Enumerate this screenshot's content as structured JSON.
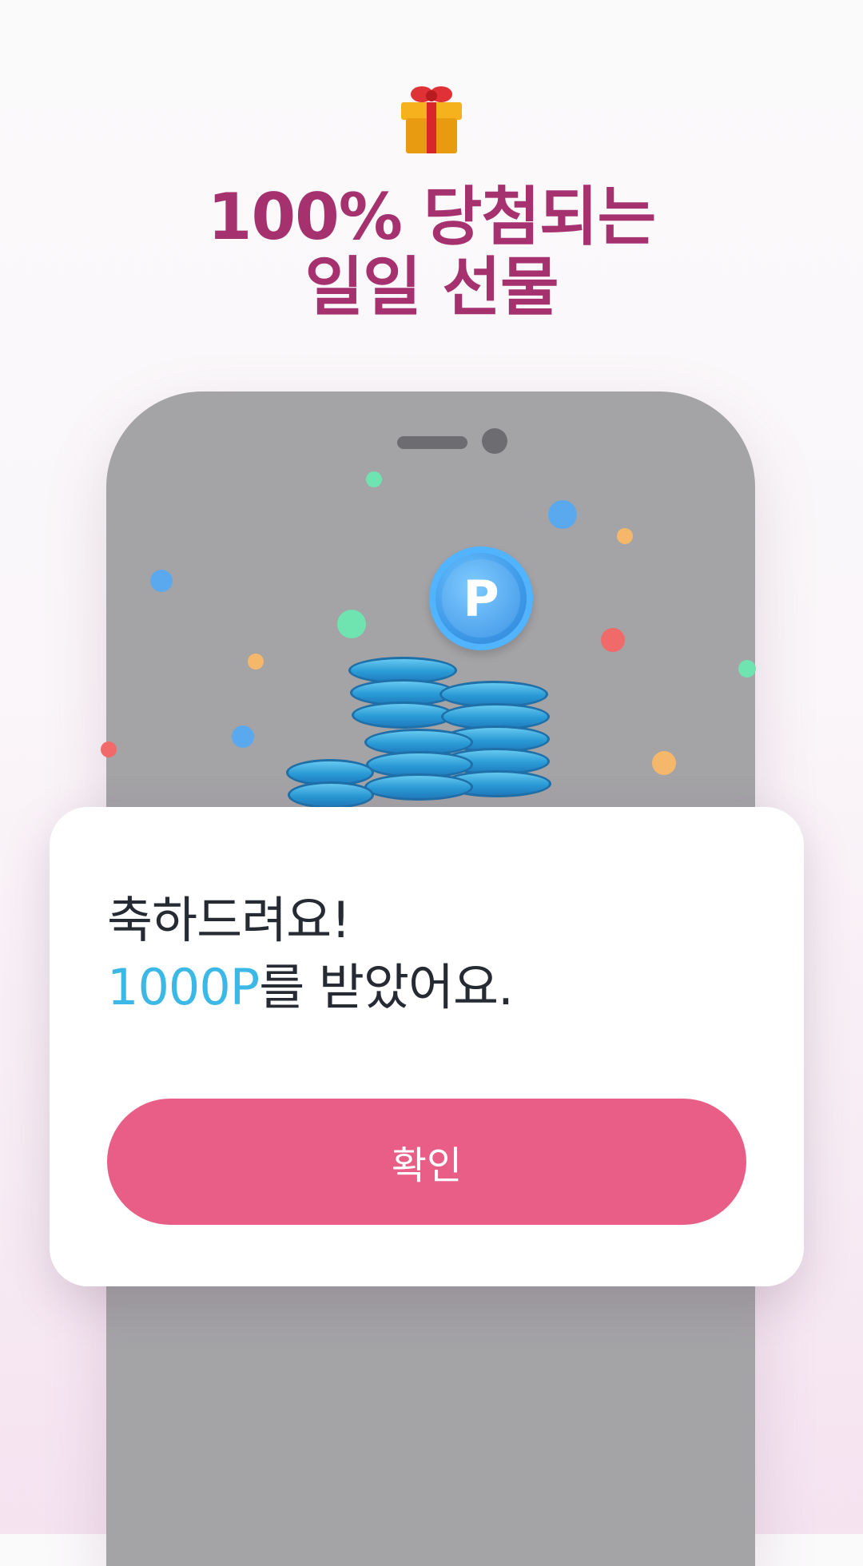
{
  "header": {
    "gift_icon": "wrapped-gift-icon",
    "title_line1": "100% 당첨되는",
    "title_line2": "일일 선물",
    "title_color": "#a5316f"
  },
  "illustration": {
    "coin_symbol": "P",
    "coin_icon": "point-coin-icon",
    "phone_color": "#a4a3a6",
    "confetti_colors": [
      "#5aa9ef",
      "#6fe3b0",
      "#f5b86a",
      "#f06a6a"
    ]
  },
  "dialog": {
    "line1": "축하드려요!",
    "points": "1000P",
    "line2_rest": "를 받았어요.",
    "points_color": "#3cb8e6",
    "confirm_label": "확인",
    "confirm_color": "#e85e86"
  }
}
